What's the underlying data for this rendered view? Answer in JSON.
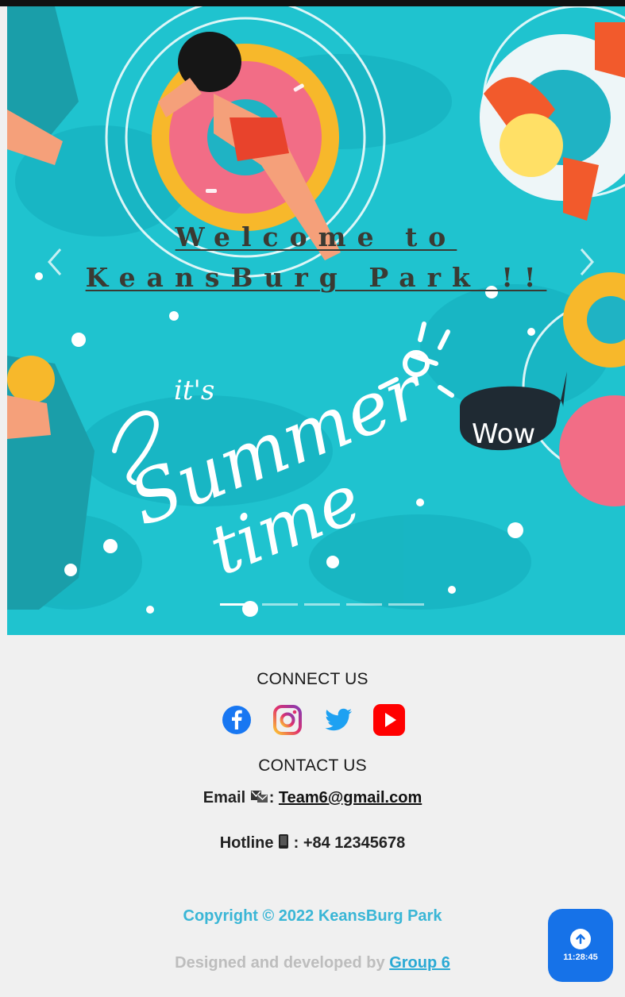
{
  "hero": {
    "welcome_line1": "Welcome to",
    "welcome_line2": "KeansBurg Park !!",
    "art_text_its": "it's",
    "art_text_summer": "Summer",
    "art_text_time": "time",
    "art_text_wow": "Wow",
    "slide_count": 5,
    "active_slide": 1,
    "prev_icon": "chevron-left-icon",
    "next_icon": "chevron-right-icon"
  },
  "footer": {
    "connect_heading": "CONNECT US",
    "socials": [
      {
        "name": "facebook",
        "icon": "facebook-icon",
        "color": "#1877f2"
      },
      {
        "name": "instagram",
        "icon": "instagram-icon",
        "color": "#e1306c"
      },
      {
        "name": "twitter",
        "icon": "twitter-icon",
        "color": "#1da1f2"
      },
      {
        "name": "youtube",
        "icon": "youtube-icon",
        "color": "#ff0000"
      }
    ],
    "contact_heading": "CONTACT US",
    "email_label": "Email",
    "email_separator": ":",
    "email_value": "Team6@gmail.com",
    "hotline_label": "Hotline",
    "hotline_separator": ":",
    "hotline_value": "+84 12345678",
    "copyright": "Copyright © 2022 KeansBurg Park",
    "designed_prefix": "Designed and developed by",
    "designed_link": "Group 6"
  },
  "back_to_top": {
    "time": "11:28:45",
    "icon": "arrow-up-icon",
    "color": "#1672e8"
  }
}
